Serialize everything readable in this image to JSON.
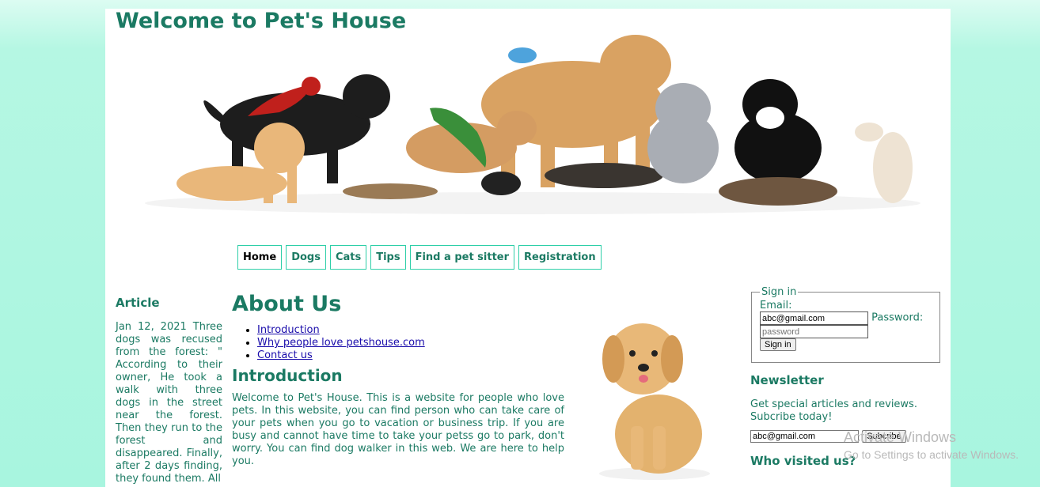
{
  "header": {
    "title": "Welcome to Pet's House"
  },
  "nav": {
    "items": [
      {
        "label": "Home"
      },
      {
        "label": "Dogs"
      },
      {
        "label": "Cats"
      },
      {
        "label": "Tips"
      },
      {
        "label": "Find a pet sitter"
      },
      {
        "label": "Registration"
      }
    ]
  },
  "article": {
    "heading": "Article",
    "text": "Jan 12, 2021 Three dogs was recused from the forest: \" According to their owner, He took a walk with three dogs in the street near the forest. Then they run to the forest and disappeared. Finally, after 2 days finding, they found them. All"
  },
  "main": {
    "title": "About Us",
    "links": [
      {
        "label": "Introduction"
      },
      {
        "label": "Why people love petshouse.com"
      },
      {
        "label": "Contact us"
      }
    ],
    "intro_heading": "Introduction",
    "intro_text": "Welcome to Pet's House. This is a website for people who love pets. In this website, you can find person who can take care of your pets when you go to vacation or business trip. If you are busy and cannot have time to take your petss go to park, don't worry. You can find dog walker in this web. We are here to help you."
  },
  "signin": {
    "legend": "Sign in",
    "email_label": "Email:",
    "email_value": "abc@gmail.com",
    "password_label": "Password:",
    "password_placeholder": "password",
    "button_label": "Sign in"
  },
  "newsletter": {
    "heading": "Newsletter",
    "text": "Get special articles and reviews. Subcribe today!",
    "email_value": "abc@gmail.com",
    "button_label": "Subcribe",
    "visited_heading": "Who visited us?"
  },
  "watermark": {
    "line1": "Activate Windows",
    "line2": "Go to Settings to activate Windows."
  },
  "colors": {
    "accent": "#1b7a63",
    "nav_border": "#2ecfa8",
    "background": "#aaf5df"
  }
}
